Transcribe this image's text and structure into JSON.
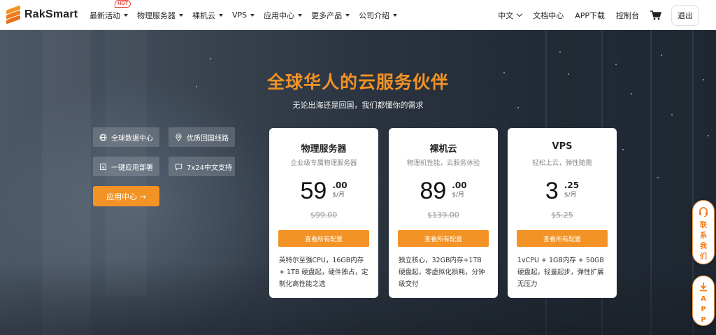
{
  "brand": {
    "name": "RakSmart",
    "accent": "#f39325"
  },
  "nav": {
    "items": [
      {
        "label": "最新活动",
        "badge": "HOT"
      },
      {
        "label": "物理服务器"
      },
      {
        "label": "裸机云"
      },
      {
        "label": "VPS"
      },
      {
        "label": "应用中心"
      },
      {
        "label": "更多产品"
      },
      {
        "label": "公司介绍"
      }
    ],
    "right": {
      "language": "中文",
      "docs": "文档中心",
      "app": "APP下载",
      "console": "控制台",
      "cart_icon": "cart-icon",
      "logout": "退出"
    }
  },
  "hero": {
    "title": "全球华人的云服务伙伴",
    "subtitle": "无论出海还是回国，我们都懂你的需求",
    "features": [
      {
        "label": "全球数据中心",
        "icon": "globe-icon"
      },
      {
        "label": "优质回国线路",
        "icon": "location-pin-icon"
      },
      {
        "label": "一键应用部署",
        "icon": "deploy-icon"
      },
      {
        "label": "7x24中文支持",
        "icon": "chat-icon"
      }
    ],
    "cta": "应用中心 →"
  },
  "cards": [
    {
      "title": "物理服务器",
      "subtitle": "企业级专属物理服务器",
      "price_int": "59",
      "price_dec": ".00",
      "unit": "$/月",
      "old_price": "$99.00",
      "button": "查看所有配置",
      "desc": "英特尔至强CPU，16GB内存 + 1TB 硬盘起，硬件独占，定制化高性能之选"
    },
    {
      "title": "裸机云",
      "subtitle": "物理机性能，云服务体验",
      "price_int": "89",
      "price_dec": ".00",
      "unit": "$/月",
      "old_price": "$139.00",
      "button": "查看所有配置",
      "desc": "独立核心，32GB内存+1TB 硬盘起，零虚拟化损耗，分钟级交付"
    },
    {
      "title": "VPS",
      "subtitle": "轻松上云，弹性随需",
      "price_int": "3",
      "price_dec": ".25",
      "unit": "$/月",
      "old_price": "$5.25",
      "button": "查看所有配置",
      "desc": "1vCPU + 1GB内存 + 50GB 硬盘起，轻量起步，弹性扩展无压力"
    }
  ],
  "floating": {
    "contact": {
      "label": "联系我们",
      "icon": "headset-icon"
    },
    "app": {
      "label": "APP",
      "icon": "download-icon"
    }
  }
}
